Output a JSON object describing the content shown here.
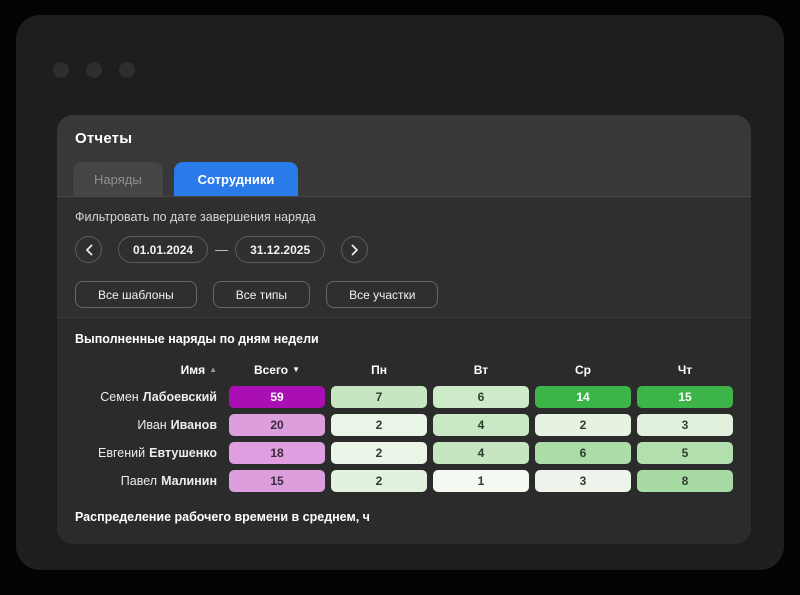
{
  "page": {
    "title": "Отчеты"
  },
  "tabs": [
    {
      "label": "Наряды",
      "active": false
    },
    {
      "label": "Сотрудники",
      "active": true
    }
  ],
  "filter": {
    "label": "Фильтровать по дате завершения наряда",
    "date_from": "01.01.2024",
    "date_to": "31.12.2025",
    "range_separator": "—",
    "buttons": [
      "Все шаблоны",
      "Все типы",
      "Все участки"
    ]
  },
  "icons": {
    "prev": "chevron-left",
    "next": "chevron-right",
    "sort_asc_glyph": "▲",
    "sort_desc_glyph": "▼"
  },
  "colors": {
    "accent_blue": "#2a7bea",
    "total_max_magenta": "#a90fb2",
    "total_light_plum": "#dc9edd",
    "day_max_green": "#3cb447"
  },
  "report": {
    "section_title": "Выполненные наряды по дням недели",
    "next_section_title": "Распределение рабочего времени в среднем, ч",
    "table": {
      "columns": [
        {
          "label": "Имя",
          "sort": "asc"
        },
        {
          "label": "Всего",
          "sort": "desc"
        },
        {
          "label": "Пн"
        },
        {
          "label": "Вт"
        },
        {
          "label": "Ср"
        },
        {
          "label": "Чт"
        }
      ],
      "rows": [
        {
          "first": "Семен",
          "last": "Лабоевский",
          "cells": [
            {
              "value": "59",
              "bg": "#a90fb2",
              "fg": "#ffffff"
            },
            {
              "value": "7",
              "bg": "#c6e6c1",
              "fg": "#2c3f2c"
            },
            {
              "value": "6",
              "bg": "#cdeac9",
              "fg": "#2c3f2c"
            },
            {
              "value": "14",
              "bg": "#3cb447",
              "fg": "#ffffff"
            },
            {
              "value": "15",
              "bg": "#3cb447",
              "fg": "#ffffff"
            }
          ]
        },
        {
          "first": "Иван",
          "last": "Иванов",
          "cells": [
            {
              "value": "20",
              "bg": "#dc9edd",
              "fg": "#3a2a3a"
            },
            {
              "value": "2",
              "bg": "#e9f5e6",
              "fg": "#2c3f2c"
            },
            {
              "value": "4",
              "bg": "#c9e8c4",
              "fg": "#2c3f2c"
            },
            {
              "value": "2",
              "bg": "#e6f3e2",
              "fg": "#2c3f2c"
            },
            {
              "value": "3",
              "bg": "#e2f0de",
              "fg": "#2c3f2c"
            }
          ]
        },
        {
          "first": "Евгений",
          "last": "Евтушенко",
          "cells": [
            {
              "value": "18",
              "bg": "#e09ee1",
              "fg": "#3a2a3a"
            },
            {
              "value": "2",
              "bg": "#ebf6e8",
              "fg": "#2c3f2c"
            },
            {
              "value": "4",
              "bg": "#c5e6c0",
              "fg": "#2c3f2c"
            },
            {
              "value": "6",
              "bg": "#acdda7",
              "fg": "#2c3f2c"
            },
            {
              "value": "5",
              "bg": "#b2dfae",
              "fg": "#2c3f2c"
            }
          ]
        },
        {
          "first": "Павел",
          "last": "Малинин",
          "cells": [
            {
              "value": "15",
              "bg": "#dc9edd",
              "fg": "#3a2a3a"
            },
            {
              "value": "2",
              "bg": "#e3f1df",
              "fg": "#2c3f2c"
            },
            {
              "value": "1",
              "bg": "#f4f9f2",
              "fg": "#2c3f2c"
            },
            {
              "value": "3",
              "bg": "#eef4ec",
              "fg": "#2c3f2c"
            },
            {
              "value": "8",
              "bg": "#a8daa3",
              "fg": "#2c3f2c"
            }
          ]
        }
      ]
    }
  }
}
